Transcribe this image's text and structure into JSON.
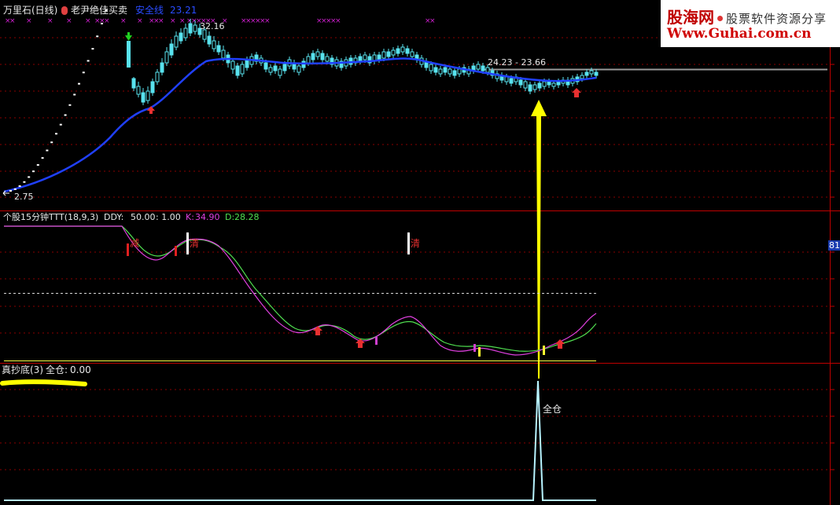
{
  "colors": {
    "background": "#000000",
    "axis": "#c00000",
    "ma_line": "#1e3cff",
    "candle_up": "#58e2ee",
    "candle_down": "#58e2ee",
    "k_line": "#e040e0",
    "d_line": "#50e050",
    "signal_line": "#b8f4ff",
    "arrow_up": "#e83030",
    "arrow_yellow": "#ffff00",
    "resistance": "#9a9a9a"
  },
  "header": {
    "stock_name": "万里石(日线)",
    "indicator_name": "老尹绝佳买卖",
    "safety_line_label": "安全线",
    "safety_line_value": "23.21"
  },
  "main_chart": {
    "high_label": "32.16",
    "low_label": "2.75",
    "range_label": "24.23 - 23.66",
    "arrow_icons": [
      "green-down-arrow",
      "red-up-arrow",
      "red-up-arrow"
    ]
  },
  "kdj_panel": {
    "title": "个股15分钟TTT(18,9,3)",
    "ddy_label": "DDY:",
    "ddy_value": "50.00",
    "ratio_label": ": 1.00",
    "k_label": "K:",
    "k_value": "34.90",
    "d_label": "D:",
    "d_value": "28.28",
    "side_value": "81.",
    "signal_texts": [
      "减",
      "清",
      "清"
    ],
    "signal_markers": [
      "red-bar",
      "red-bar",
      "white-bar",
      "white-bar",
      "magenta-bar",
      "magenta-bar",
      "yellow-bar",
      "yellow-bar"
    ]
  },
  "bottom_panel": {
    "title": "真抄底(3)",
    "label": "全仓:",
    "value": "0.00",
    "peak_label": "全仓"
  },
  "watermark": {
    "brand": "股海网",
    "slogan": "股票软件资源分享",
    "url": "Www.Guhai.com.cn"
  }
}
